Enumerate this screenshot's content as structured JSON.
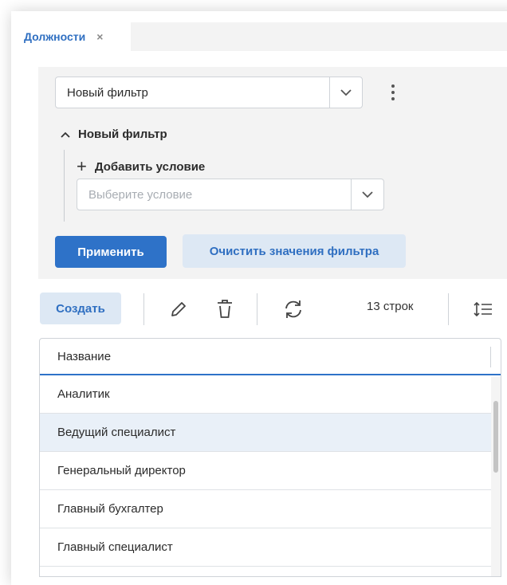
{
  "tabs": [
    {
      "label": "Должности",
      "close": "×"
    }
  ],
  "filter": {
    "saved_filter_value": "Новый фильтр",
    "group_title": "Новый фильтр",
    "add_condition_label": "Добавить условие",
    "condition_placeholder": "Выберите условие",
    "apply_label": "Применить",
    "clear_label": "Очистить значения фильтра"
  },
  "toolbar": {
    "create_label": "Создать",
    "row_count": "13 строк"
  },
  "table": {
    "columns": [
      "Название"
    ],
    "rows": [
      "Аналитик",
      "Ведущий специалист",
      "Генеральный директор",
      "Главный бухгалтер",
      "Главный специалист"
    ],
    "selected_row": 1
  },
  "colors": {
    "accent": "#2e72c8",
    "accent_soft": "#dde8f4",
    "panel": "#f3f3f3",
    "selected_row": "#e9f0f8"
  }
}
